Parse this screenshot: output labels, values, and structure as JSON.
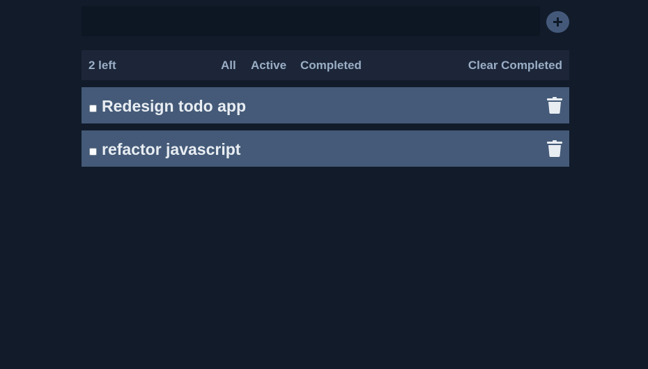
{
  "new_todo": {
    "value": "",
    "placeholder": ""
  },
  "add_button": {
    "icon": "plus-icon",
    "accent": "#44597a"
  },
  "filter_bar": {
    "items_left": "2 left",
    "filters": {
      "all": "All",
      "active": "Active",
      "completed": "Completed"
    },
    "clear_completed": "Clear Completed"
  },
  "todos": [
    {
      "text": "Redesign todo app",
      "completed": false,
      "delete_icon": "trash-icon"
    },
    {
      "text": "refactor javascript",
      "completed": false,
      "delete_icon": "trash-icon"
    }
  ],
  "colors": {
    "background": "#111b2a",
    "input_background": "#0c1723",
    "filter_bar_background": "#1c2638",
    "filter_text": "#9aaec6",
    "todo_background": "#445a78",
    "todo_text": "#e8edf2"
  }
}
